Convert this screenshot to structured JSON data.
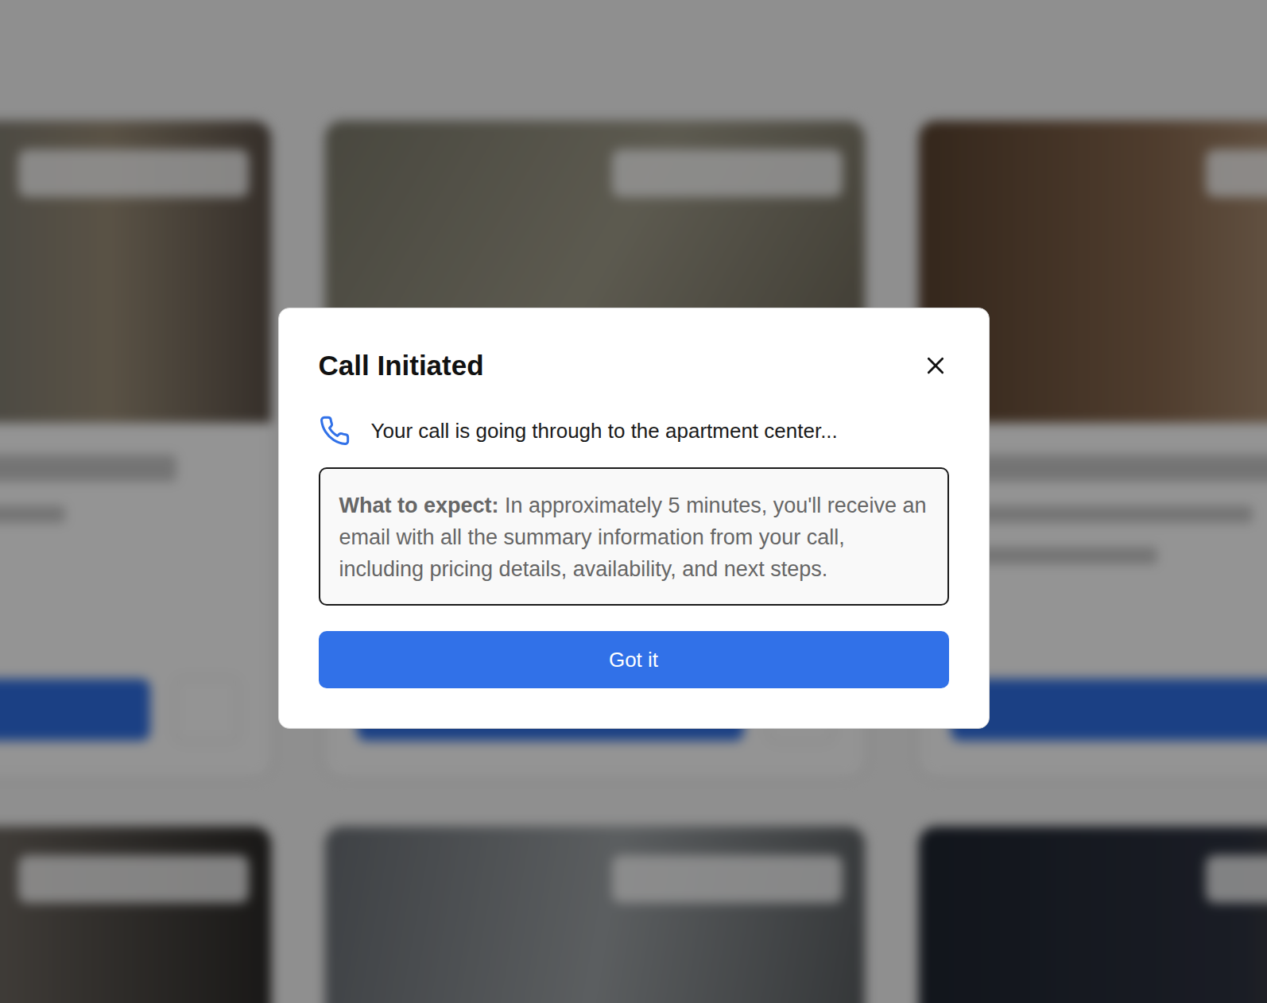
{
  "dialog": {
    "title": "Call Initiated",
    "message": "Your call is going through to the apartment center...",
    "expect_label": "What to expect:",
    "expect_text": " In approximately 5 minutes, you'll receive an email with all the summary information from your call, including pricing details, availability, and next steps.",
    "button": "Got it"
  }
}
